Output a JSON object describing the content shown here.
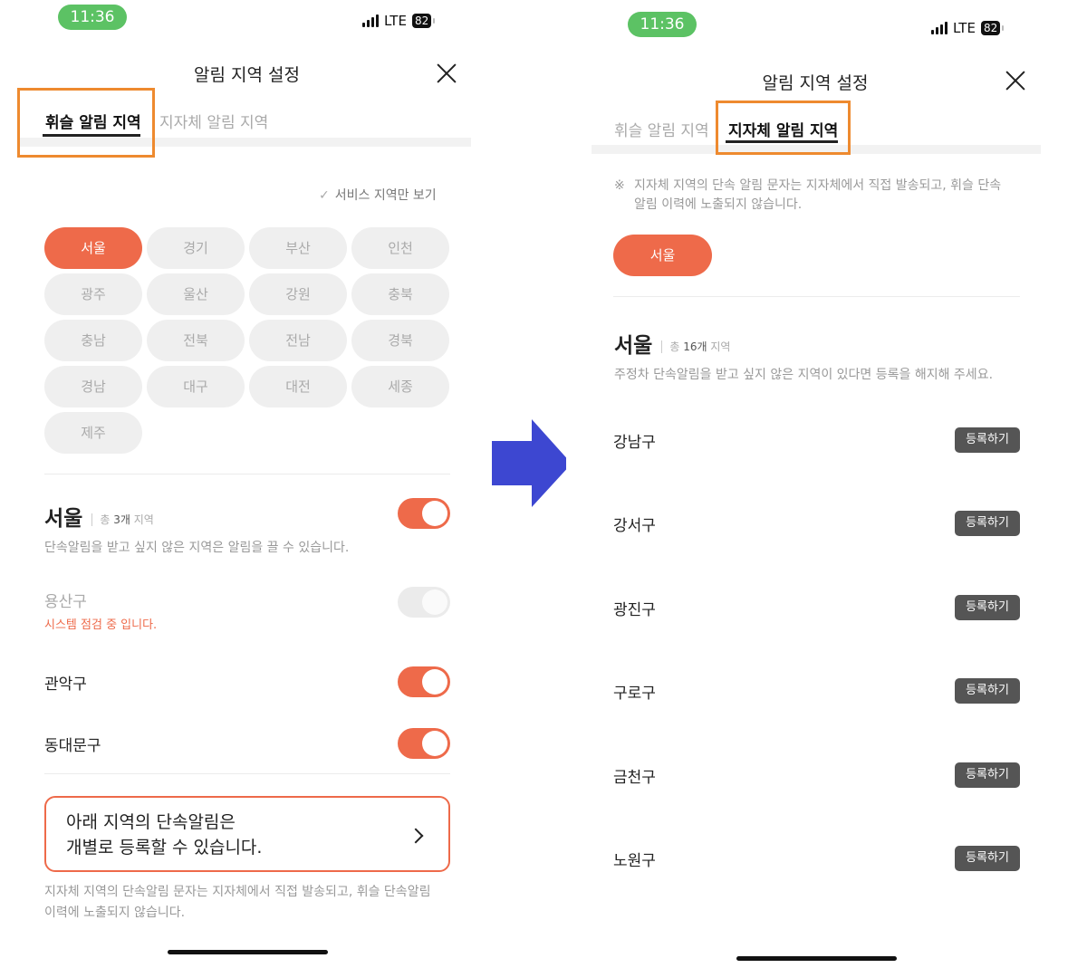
{
  "colors": {
    "accent": "#ee6a4a",
    "highlight": "#ee8a2f",
    "arrow": "#3d47d1",
    "status_pill": "#5cc264"
  },
  "left_screen": {
    "status": {
      "time": "11:36",
      "network": "LTE",
      "battery": "82"
    },
    "header": {
      "title": "알림 지역 설정",
      "close_icon": "close-icon"
    },
    "tabs": [
      {
        "label": "휘슬 알림 지역",
        "active": true
      },
      {
        "label": "지자체 알림 지역",
        "active": false
      }
    ],
    "service_filter": {
      "label": "서비스 지역만 보기",
      "checked": false
    },
    "regions": [
      "서울",
      "경기",
      "부산",
      "인천",
      "광주",
      "울산",
      "강원",
      "충북",
      "충남",
      "전북",
      "전남",
      "경북",
      "경남",
      "대구",
      "대전",
      "세종",
      "제주"
    ],
    "selected_region": "서울",
    "section": {
      "title": "서울",
      "count_prefix": "총 ",
      "count_number": "3개",
      "count_suffix": " 지역",
      "enabled": true,
      "description": "단속알림을 받고 싶지 않은 지역은 알림을 끌 수 있습니다."
    },
    "districts": [
      {
        "name": "용산구",
        "status": "시스템 점검 중 입니다.",
        "enabled": false,
        "disabled": true
      },
      {
        "name": "관악구",
        "enabled": true
      },
      {
        "name": "동대문구",
        "enabled": true
      }
    ],
    "cta": {
      "line1": "아래 지역의 단속알림은",
      "line2": "개별로 등록할 수 있습니다."
    },
    "footnote": {
      "line1": "지자체 지역의 단속알림 문자는 지자체에서 직접 발송되고, 휘슬 단속알림",
      "line2": "이력에 노출되지 않습니다."
    }
  },
  "right_screen": {
    "status": {
      "time": "11:36",
      "network": "LTE",
      "battery": "82"
    },
    "header": {
      "title": "알림 지역 설정",
      "close_icon": "close-icon"
    },
    "tabs": [
      {
        "label": "휘슬 알림 지역",
        "active": false
      },
      {
        "label": "지자체 알림 지역",
        "active": true
      }
    ],
    "notice": {
      "mark": "※",
      "line1": "지자체 지역의 단속 알림 문자는 지자체에서 직접 발송되고, 휘슬 단속",
      "line2": "알림 이력에 노출되지 않습니다."
    },
    "selected_region": "서울",
    "section": {
      "title": "서울",
      "count_prefix": "총 ",
      "count_number": "16개",
      "count_suffix": " 지역",
      "description": "주정차 단속알림을 받고 싶지 않은 지역이 있다면 등록을 해지해 주세요."
    },
    "districts": [
      {
        "name": "강남구",
        "button": "등록하기"
      },
      {
        "name": "강서구",
        "button": "등록하기"
      },
      {
        "name": "광진구",
        "button": "등록하기"
      },
      {
        "name": "구로구",
        "button": "등록하기"
      },
      {
        "name": "금천구",
        "button": "등록하기"
      },
      {
        "name": "노원구",
        "button": "등록하기"
      }
    ]
  },
  "transition_arrow": "right-arrow-icon"
}
